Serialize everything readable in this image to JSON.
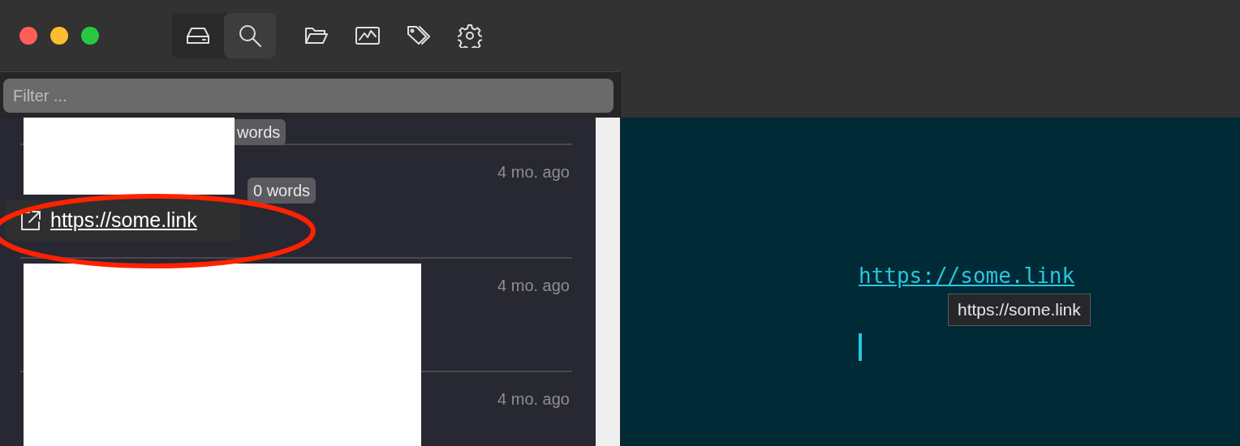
{
  "sidebar_modes": [
    {
      "kind": "drive",
      "selected": false
    },
    {
      "kind": "search",
      "selected": true
    }
  ],
  "toolbar": [
    {
      "kind": "folder"
    },
    {
      "kind": "chart"
    },
    {
      "kind": "tag"
    },
    {
      "kind": "settings"
    }
  ],
  "filter": {
    "placeholder": "Filter ..."
  },
  "files": [
    {
      "badge": "words"
    },
    {
      "date": "4 mo. ago",
      "badge": "0 words"
    },
    {
      "date": "4 mo. ago"
    },
    {
      "date": "4 mo. ago"
    }
  ],
  "link_popup": {
    "url": "https://some.link"
  },
  "editor": {
    "link": "https://some.link",
    "tooltip": "https://some.link"
  }
}
